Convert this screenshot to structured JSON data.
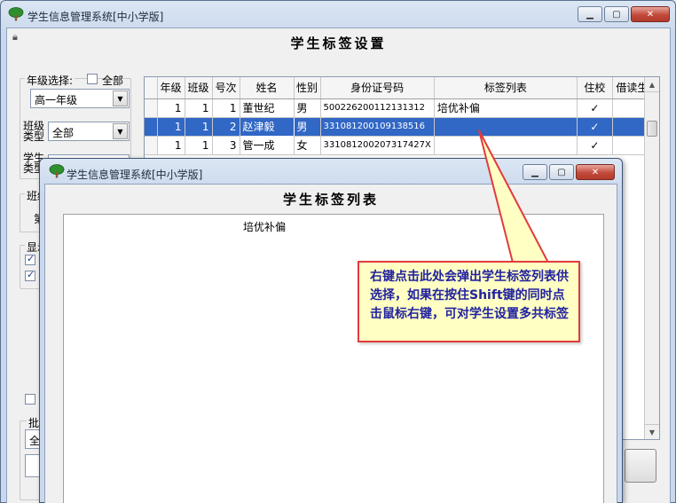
{
  "window": {
    "title": "学生信息管理系统[中小学版]",
    "min_icon": "minimize-icon",
    "max_icon": "maximize-icon",
    "close_icon": "close-icon"
  },
  "main": {
    "title": "学生标签设置",
    "grade_label": "年级选择:",
    "all_grade_label": "全部",
    "grade_value": "高一年级",
    "class_type_label_1": "班级",
    "class_type_label_2": "类型",
    "class_type_value": "全部",
    "student_type_label_1": "学生",
    "student_type_label_2": "类型",
    "class_group_label": "班级",
    "class_group_item": "第",
    "display_group_label": "显示",
    "batch_group_label": "批",
    "batch_value": "全"
  },
  "table": {
    "columns": [
      "年级",
      "班级",
      "号次",
      "姓名",
      "性别",
      "身份证号码",
      "标签列表",
      "住校",
      "借读生"
    ],
    "rows": [
      {
        "grade": "1",
        "class": "1",
        "no": "1",
        "name": "董世纪",
        "sex": "男",
        "id": "500226200112131312",
        "tags": "培优补偏",
        "boarding": "✓",
        "transfer": ""
      },
      {
        "grade": "1",
        "class": "1",
        "no": "2",
        "name": "赵津毅",
        "sex": "男",
        "id": "331081200109138516",
        "tags": "",
        "boarding": "✓",
        "transfer": ""
      },
      {
        "grade": "1",
        "class": "1",
        "no": "3",
        "name": "管一成",
        "sex": "女",
        "id": "331081200207317427X",
        "tags": "",
        "boarding": "✓",
        "transfer": ""
      }
    ],
    "selected_row": 1
  },
  "popup": {
    "title": "学生信息管理系统[中小学版]",
    "heading": "学生标签列表",
    "tags": [
      "培优补偏"
    ]
  },
  "callout": {
    "text": "右键点击此处会弹出学生标签列表供选择，如果在按住Shift键的同时点击鼠标右键，可对学生设置多共标签"
  },
  "colors": {
    "selection": "#3167c5",
    "callout_border": "#e23b3b",
    "callout_bg": "#ffffc4",
    "callout_text": "#2222a0"
  }
}
